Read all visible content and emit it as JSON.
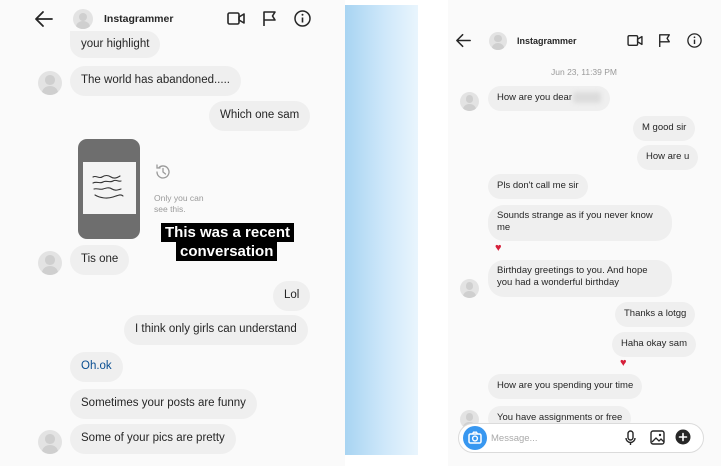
{
  "left": {
    "header": {
      "title": "Instagrammer",
      "icons": [
        "back-arrow-icon",
        "video-call-icon",
        "flag-icon",
        "info-icon"
      ]
    },
    "messages": [
      {
        "side": "received",
        "text": "your highlight"
      },
      {
        "side": "received",
        "text": "The world has abandoned....."
      },
      {
        "side": "sent",
        "text": "Which one sam"
      },
      {
        "side": "received",
        "text": "Tis one"
      },
      {
        "side": "sent",
        "text": "Lol"
      },
      {
        "side": "sent",
        "text": "I think only girls can understand"
      },
      {
        "side": "received",
        "text": "Oh.ok"
      },
      {
        "side": "received",
        "text": "Sometimes your posts are funny"
      },
      {
        "side": "received",
        "text": "Some of your pics are pretty"
      }
    ],
    "story": {
      "unavailable_text": "Only you can see this.",
      "thumbnail": "handwritten-note-thumbnail"
    },
    "overlay": {
      "line1": "This was a recent",
      "line2": "conversation"
    }
  },
  "right": {
    "header": {
      "title": "Instagrammer",
      "icons": [
        "back-arrow-icon",
        "video-call-icon",
        "flag-icon",
        "info-icon"
      ]
    },
    "timestamp": "Jun 23, 11:39 PM",
    "messages": [
      {
        "side": "received",
        "text": "How are you dear"
      },
      {
        "side": "sent",
        "text": "M good sir"
      },
      {
        "side": "sent",
        "text": "How are u"
      },
      {
        "side": "received",
        "text": "Pls don't call me sir"
      },
      {
        "side": "received",
        "text": "Sounds strange as if you never know me",
        "reaction": "heart"
      },
      {
        "side": "received",
        "text": "Birthday greetings to you. And hope you had a wonderful birthday"
      },
      {
        "side": "sent",
        "text": "Thanks a lotgg"
      },
      {
        "side": "sent",
        "text": "Haha okay sam",
        "reaction": "heart"
      },
      {
        "side": "received",
        "text": "How are you spending your time"
      },
      {
        "side": "received",
        "text": "You have assignments or free"
      }
    ],
    "composer": {
      "placeholder": "Message...",
      "icons": [
        "camera-icon",
        "microphone-icon",
        "gallery-icon",
        "add-icon"
      ]
    }
  },
  "colors": {
    "accent": "#3897f0",
    "bubble": "#efefef",
    "heart": "#d61f3a",
    "divider": "#a8d4f2"
  }
}
